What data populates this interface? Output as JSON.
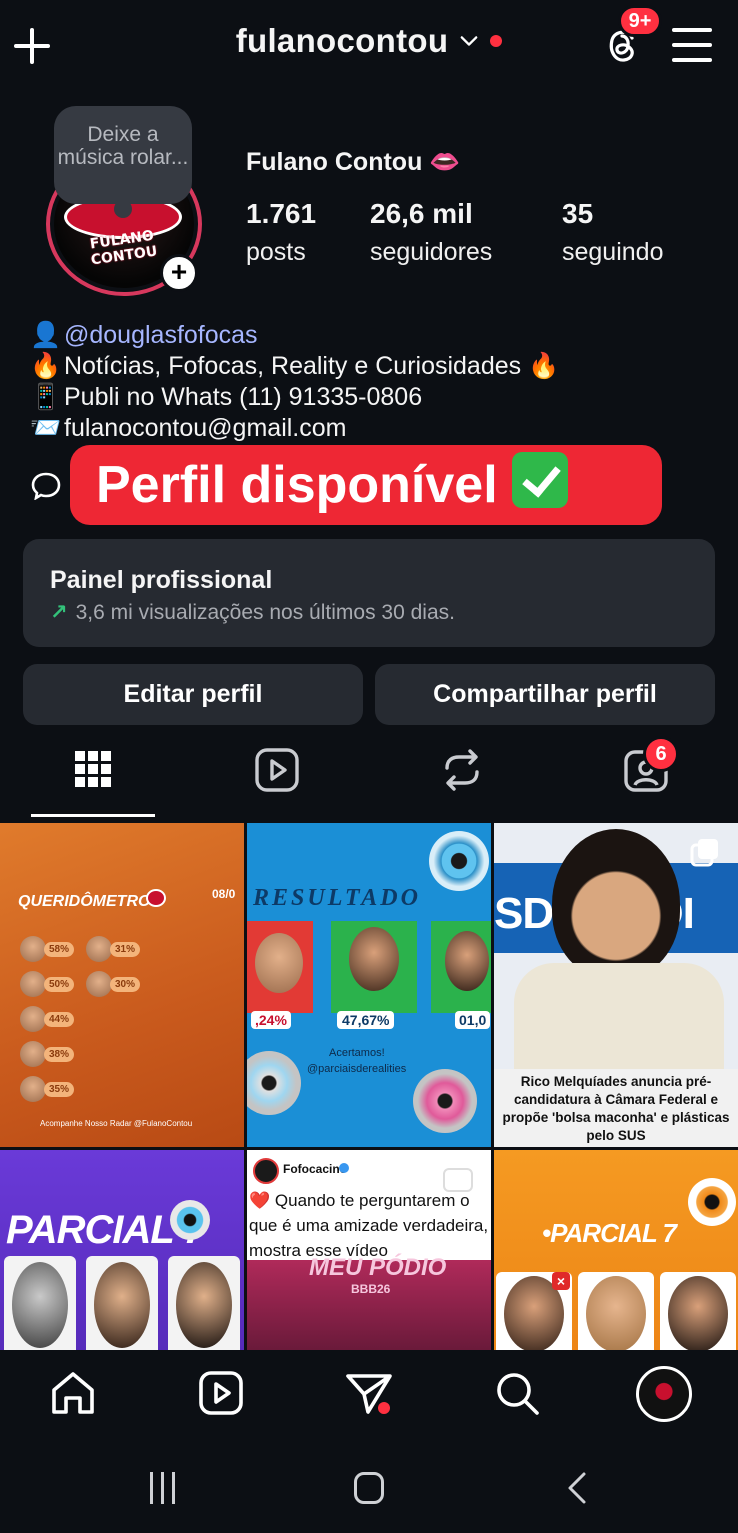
{
  "header": {
    "username": "fulanocontou",
    "threads_badge": "9+"
  },
  "profile": {
    "note": "Deixe a música rolar...",
    "name": "Fulano Contou 👄",
    "avatar_text": "FULANO CONTOU",
    "stats": [
      {
        "value": "1.761",
        "label": "posts"
      },
      {
        "value": "26,6 mil",
        "label": "seguidores"
      },
      {
        "value": "35",
        "label": "seguindo"
      }
    ]
  },
  "bio": {
    "lines": [
      {
        "icon": "👤",
        "text": "@douglasfofocas"
      },
      {
        "icon": "🔥",
        "text": "Notícias, Fofocas, Reality e Curiosidades 🔥"
      },
      {
        "icon": "📱",
        "text": "Publi no Whats (11) 91335-0806"
      },
      {
        "icon": "📨",
        "text": "fulanocontou@gmail.com"
      }
    ]
  },
  "banner": {
    "text": "Perfil disponível"
  },
  "professional_panel": {
    "title": "Painel profissional",
    "subtitle": "3,6 mi visualizações nos últimos 30 dias."
  },
  "buttons": {
    "edit": "Editar perfil",
    "share": "Compartilhar perfil"
  },
  "tabs": {
    "tagged_badge": "6"
  },
  "posts": {
    "p1": {
      "title": "QUERIDÔMETRO",
      "date": "08/0",
      "percents": [
        "58%",
        "50%",
        "44%",
        "38%",
        "35%",
        "31%",
        "30%"
      ],
      "footer": "Acompanhe Nosso Radar @FulanoContou"
    },
    "p2": {
      "title": "RESULTADO",
      "left": ",24%",
      "mid": "47,67%",
      "right": "01,0",
      "caption1": "Acertamos!",
      "caption2": "@parciaisderealities"
    },
    "p3": {
      "bg": "SDB  PSDI",
      "caption": "Rico Melquíades anuncia pré-candidatura à Câmara Federal e propõe 'bolsa maconha' e plásticas pelo SUS"
    },
    "p4": {
      "title": "PARCIAL 7"
    },
    "p5": {
      "account": "Fofocacine",
      "text": "❤️ Quando te perguntarem o que é uma amizade verdadeira, mostra esse vídeo",
      "sub1": "MEU PÓDIO",
      "sub2": "BBB26"
    },
    "p6": {
      "title": "•PARCIAL 7"
    }
  },
  "colors": {
    "background": "#0c0f14",
    "panel": "#262a31",
    "accent_red": "#ff3040",
    "banner_red": "#ee2734",
    "link": "#a6b6ff"
  }
}
